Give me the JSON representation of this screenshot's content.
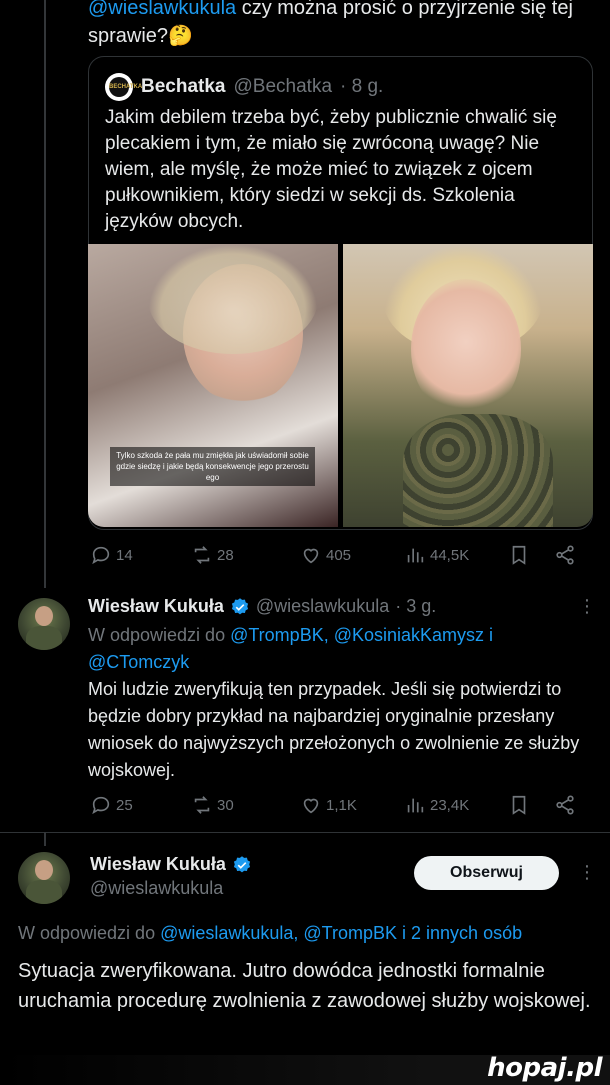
{
  "top_tweet": {
    "mention": "@wieslawkukula",
    "text_line1": " czy można prosić o przyjrzenie się tej",
    "text_line2": "sprawie?🤔"
  },
  "quote": {
    "name": "Bechatka",
    "handle": "@Bechatka",
    "time": "· 8 g.",
    "avatar_text": "BECHATKA",
    "text": "Jakim debilem trzeba być, żeby publicznie chwalić się plecakiem i tym, że miało się zwróconą uwagę? Nie wiem, ale myślę, że może mieć to związek z ojcem pułkownikiem, który siedzi w sekcji ds. Szkolenia języków obcych.",
    "image_caption": "Tylko szkoda że pała mu zmiękła jak uświadomił sobie gdzie siedzę i jakie będą konsekwencje jego przerostu ego"
  },
  "actions_1": {
    "replies": "14",
    "reposts": "28",
    "likes": "405",
    "views": "44,5K"
  },
  "reply_tweet": {
    "name": "Wiesław Kukuła",
    "handle": "@wieslawkukula",
    "time": "· 3 g.",
    "reply_prefix": "W odpowiedzi do ",
    "reply_mentions_1": "@TrompBK, @KosiniakKamysz i",
    "reply_mentions_2": "@CTomczyk",
    "text": "Moi ludzie zweryfikują ten przypadek. Jeśli się potwierdzi to będzie dobry przykład na najbardziej oryginalnie przesłany wniosek do najwyższych przełożonych o zwolnienie ze służby wojskowej."
  },
  "actions_2": {
    "replies": "25",
    "reposts": "30",
    "likes": "1,1K",
    "views": "23,4K"
  },
  "main_tweet": {
    "name": "Wiesław Kukuła",
    "handle": "@wieslawkukula",
    "follow_label": "Obserwuj",
    "reply_prefix": "W odpowiedzi do ",
    "reply_mentions": "@wieslawkukula, @TrompBK i 2 innych osób",
    "text": "Sytuacja zweryfikowana. Jutro dowódca jednostki formalnie uruchamia procedurę zwolnienia z zawodowej służby wojskowej."
  },
  "watermark": "hopaj.pl",
  "colors": {
    "link": "#1d9bf0",
    "muted": "#71767b",
    "text": "#e7e9ea",
    "verified": "#1d9bf0"
  },
  "icons": [
    "reply-icon",
    "repost-icon",
    "like-icon",
    "views-icon",
    "bookmark-icon",
    "share-icon",
    "verified-icon",
    "more-icon"
  ]
}
